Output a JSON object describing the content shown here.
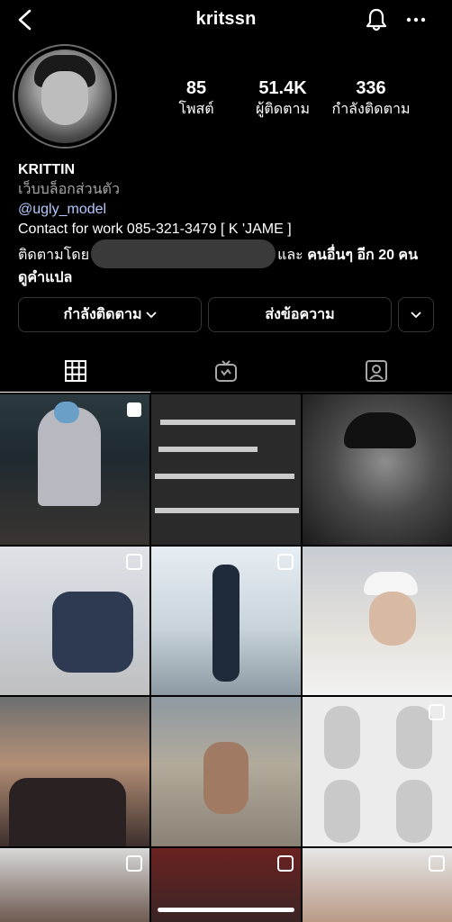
{
  "header": {
    "username": "kritssn",
    "icons": [
      "back-arrow-icon",
      "bell-icon",
      "more-options-icon"
    ]
  },
  "profile": {
    "stats": [
      {
        "value": "85",
        "label": "โพสต์"
      },
      {
        "value": "51.4K",
        "label": "ผู้ติดตาม"
      },
      {
        "value": "336",
        "label": "กำลังติดตาม"
      }
    ],
    "name": "KRITTIN",
    "category": "เว็บบล็อกส่วนตัว",
    "mention": "@ugly_model",
    "contact": "Contact for work 085-321-3479 [ K 'JAME ]",
    "followed_by_prefix": "ติดตามโดย",
    "followed_by_suffix_normal": "และ ",
    "followed_by_suffix_bold": "คนอื่นๆ อีก 20 คน",
    "translate": "ดูคำแปล"
  },
  "actions": {
    "following_label": "กำลังติดตาม",
    "message_label": "ส่งข้อความ"
  },
  "tabs": [
    "grid-icon",
    "igtv-icon",
    "tagged-icon"
  ],
  "colors": {
    "background": "#000000",
    "link": "#b3c9ff",
    "secondary_text": "#a8a8a8",
    "border": "#363636"
  }
}
